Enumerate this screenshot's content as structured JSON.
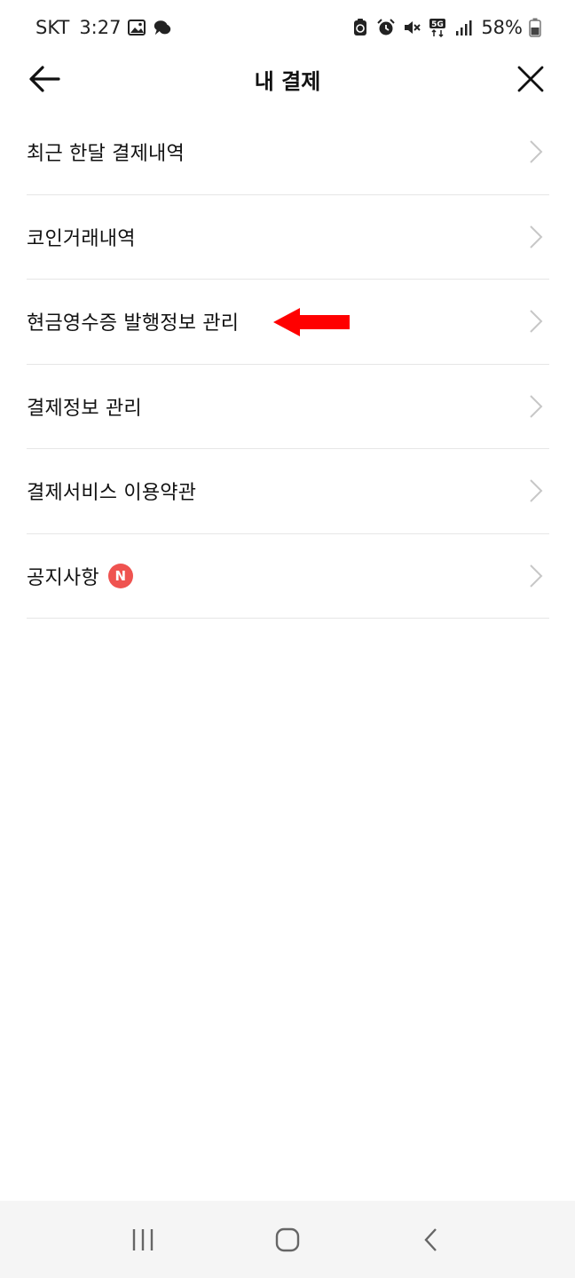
{
  "status_bar": {
    "carrier": "SKT",
    "time": "3:27",
    "network": "5G",
    "battery": "58%"
  },
  "header": {
    "title": "내 결제"
  },
  "menu": [
    {
      "label": "최근 한달 결제내역"
    },
    {
      "label": "코인거래내역"
    },
    {
      "label": "현금영수증 발행정보 관리"
    },
    {
      "label": "결제정보 관리"
    },
    {
      "label": "결제서비스 이용약관"
    },
    {
      "label": "공지사항",
      "badge": "N"
    }
  ],
  "colors": {
    "badge": "#ef5350",
    "annotation_arrow": "#ff0000",
    "divider": "#e6e6e6",
    "nav_bar": "#f5f5f5"
  }
}
